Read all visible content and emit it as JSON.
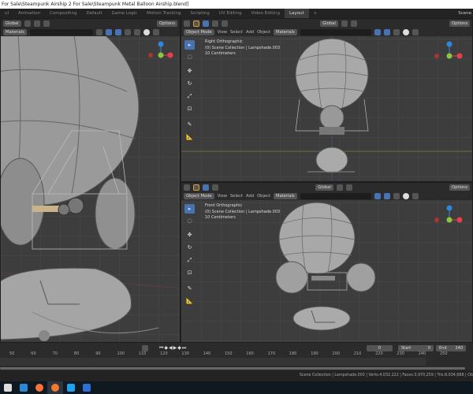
{
  "window": {
    "title": "For Sale\\Steampunk Airship 2 For Sale\\Steampunk Metal Balloon Airship.blend]"
  },
  "workspaces": [
    "ul",
    "Animation",
    "Compositing",
    "Default",
    "Game Logic",
    "Motion Tracking",
    "Scripting",
    "UV Editing",
    "Video Editing",
    "Layout"
  ],
  "active_workspace": "Layout",
  "add_tab": "+",
  "scene_label": "Scene",
  "header": {
    "orientation": "Global",
    "options": "Options",
    "object_mode": "Object Mode",
    "view": "View",
    "select": "Select",
    "add": "Add",
    "object": "Object",
    "materials": "Materials"
  },
  "viewports": [
    {
      "name": "left",
      "view": "",
      "collection": "",
      "scale": ""
    },
    {
      "name": "right",
      "view": "Right Orthographic",
      "collection": "(0) Scene Collection | Lampshade.003",
      "scale": "10 Centimeters"
    },
    {
      "name": "front",
      "view": "Front Orthographic",
      "collection": "(0) Scene Collection | Lampshade.003",
      "scale": "10 Centimeters"
    }
  ],
  "gizmo": {
    "z": "Z",
    "y": "Y",
    "x": "X",
    "colors": {
      "x": "#e83e4f",
      "y": "#8cc63f",
      "z": "#2e86de"
    }
  },
  "timeline": {
    "current_frame": "0",
    "start_label": "Start",
    "start": "0",
    "end_label": "End",
    "end": "240",
    "ticks": [
      "50",
      "60",
      "70",
      "80",
      "90",
      "100",
      "110",
      "120",
      "130",
      "140",
      "150",
      "160",
      "170",
      "180",
      "190",
      "200",
      "210",
      "220",
      "230",
      "240",
      "250"
    ]
  },
  "status": "Scene Collection | Lampshade.003 | Verts:4,032,222 | Faces:3,970,259 | Tris:8,034,688 | Ob",
  "taskbar": [
    {
      "name": "store",
      "color": "#ddd"
    },
    {
      "name": "mail",
      "color": "#2b88d8"
    },
    {
      "name": "firefox",
      "color": "#ff7139"
    },
    {
      "name": "blender",
      "color": "#f5792a"
    },
    {
      "name": "twitter",
      "color": "#1da1f2"
    },
    {
      "name": "app",
      "color": "#2b6fd8"
    }
  ],
  "accent": "#4772b3"
}
